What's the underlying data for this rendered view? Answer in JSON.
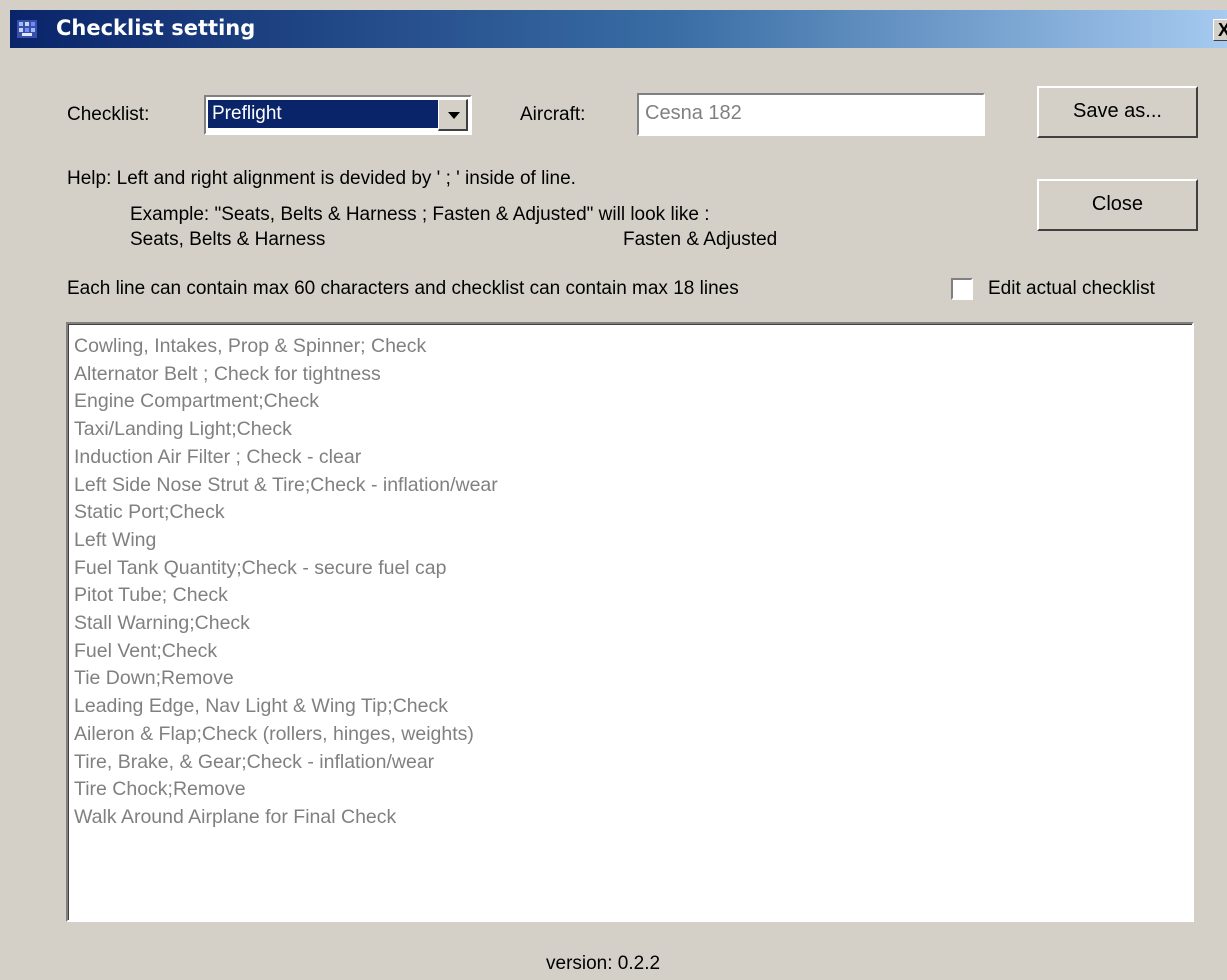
{
  "window": {
    "title": "Checklist setting",
    "close_glyph": "X",
    "icon": "app-icon"
  },
  "form": {
    "checklist_label": "Checklist:",
    "checklist_selected": "Preflight",
    "aircraft_label": "Aircraft:",
    "aircraft_value": "Cesna 182",
    "save_as_label": "Save as...",
    "close_label": "Close"
  },
  "help": {
    "line1": "Help: Left and right alignment is devided by  ' ; '  inside of line.",
    "line2": "Example: \"Seats, Belts & Harness ;  Fasten & Adjusted\" will look like :",
    "example_left": "Seats, Belts & Harness",
    "example_right": "Fasten & Adjusted",
    "limits": "Each line can contain max 60 characters and checklist can contain max 18 lines"
  },
  "edit_checkbox": {
    "label": "Edit actual checklist",
    "checked": false
  },
  "checklist_lines": [
    "Cowling, Intakes, Prop & Spinner; Check",
    "Alternator Belt ; Check for tightness",
    "Engine Compartment;Check",
    "Taxi/Landing Light;Check",
    "Induction Air Filter ; Check - clear",
    "Left Side Nose Strut & Tire;Check - inflation/wear",
    "Static Port;Check",
    "Left Wing",
    "Fuel Tank Quantity;Check - secure fuel cap",
    "Pitot Tube; Check",
    "Stall Warning;Check",
    "Fuel Vent;Check",
    "Tie Down;Remove",
    "Leading Edge, Nav Light & Wing Tip;Check",
    "Aileron & Flap;Check (rollers, hinges, weights)",
    "Tire, Brake, & Gear;Check - inflation/wear",
    "Tire Chock;Remove",
    "Walk Around Airplane for Final Check"
  ],
  "footer": {
    "version": "version: 0.2.2"
  },
  "colors": {
    "face": "#d4d0c8",
    "title_dark": "#0a246a",
    "title_light": "#a6caf0",
    "disabled_text": "#808080",
    "selection": "#0a246a"
  }
}
